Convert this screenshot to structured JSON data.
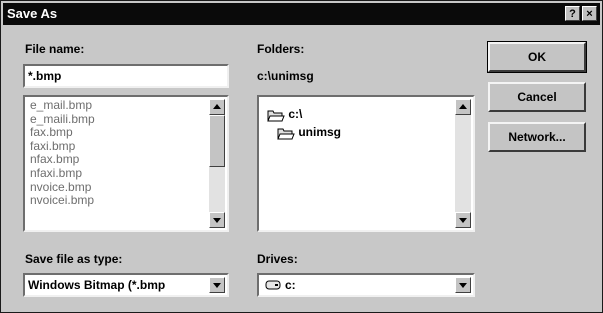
{
  "window": {
    "title": "Save As",
    "help_glyph": "?",
    "close_glyph": "×"
  },
  "filename": {
    "label": "File name:",
    "value": "*.bmp",
    "files": [
      "e_mail.bmp",
      "e_maili.bmp",
      "fax.bmp",
      "faxi.bmp",
      "nfax.bmp",
      "nfaxi.bmp",
      "nvoice.bmp",
      "nvoicei.bmp"
    ]
  },
  "folders": {
    "label": "Folders:",
    "current_path": "c:\\unimsg",
    "tree": [
      "c:\\",
      "unimsg"
    ]
  },
  "save_type": {
    "label": "Save file as type:",
    "value": "Windows Bitmap (*.bmp"
  },
  "drives": {
    "label": "Drives:",
    "value": "c:"
  },
  "buttons": {
    "ok": "OK",
    "cancel": "Cancel",
    "network": "Network..."
  },
  "icons": {
    "help": "help-icon",
    "close": "close-icon",
    "open_folder": "open-folder-icon",
    "drive": "hard-drive-icon",
    "scroll_up": "scroll-up-arrow-icon",
    "scroll_down": "scroll-down-arrow-icon",
    "dropdown": "dropdown-arrow-icon"
  },
  "colors": {
    "titlebar": "#0a0a0a",
    "dialog_face": "#c8c8c8",
    "list_text": "#6e6e6e"
  }
}
